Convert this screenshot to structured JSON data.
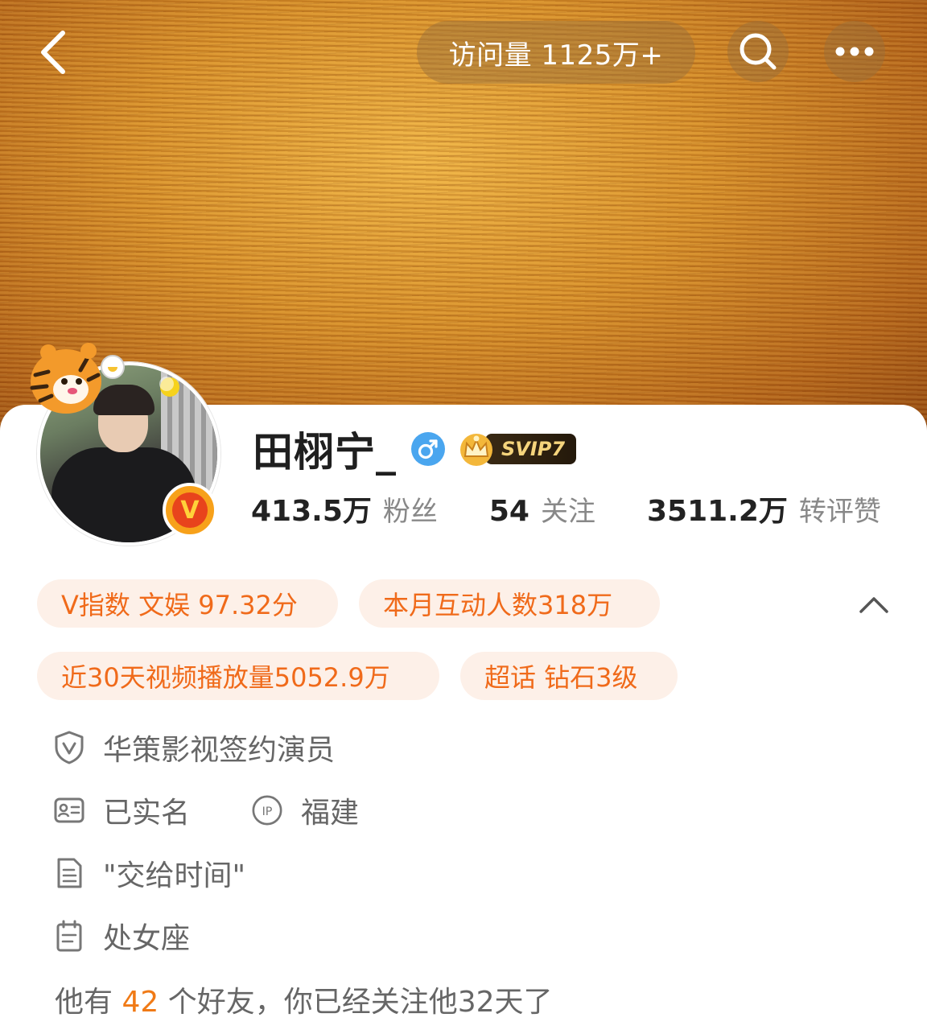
{
  "header": {
    "visit_label": "访问量 1125万+",
    "back_icon": "chevron-left-icon",
    "search_icon": "search-icon",
    "more_icon": "more-horizontal-icon"
  },
  "profile": {
    "name": "田栩宁_",
    "gender": "♂",
    "membership": "SVIP7",
    "verified_badge": "V"
  },
  "stats": [
    {
      "value": "413.5万",
      "label": "粉丝"
    },
    {
      "value": "54",
      "label": "关注"
    },
    {
      "value": "3511.2万",
      "label": "转评赞"
    }
  ],
  "tags": [
    "V指数 文娱 97.32分",
    "本月互动人数318万",
    "近30天视频播放量5052.9万",
    "超话 钻石3级"
  ],
  "info": {
    "certification": "华策影视签约演员",
    "real_name": "已实名",
    "ip_label": "IP",
    "ip_location": "福建",
    "bio": "\"交给时间\"",
    "constellation": "处女座"
  },
  "friends": {
    "prefix": "他有 ",
    "count": "42",
    "suffix": " 个好友，你已经关注他32天了"
  },
  "colors": {
    "accent": "#f06a1a",
    "tag_bg": "#fdf0e8",
    "gender_blue": "#4aa6ef",
    "text_dark": "#1f1f1f",
    "text_muted": "#888888"
  }
}
